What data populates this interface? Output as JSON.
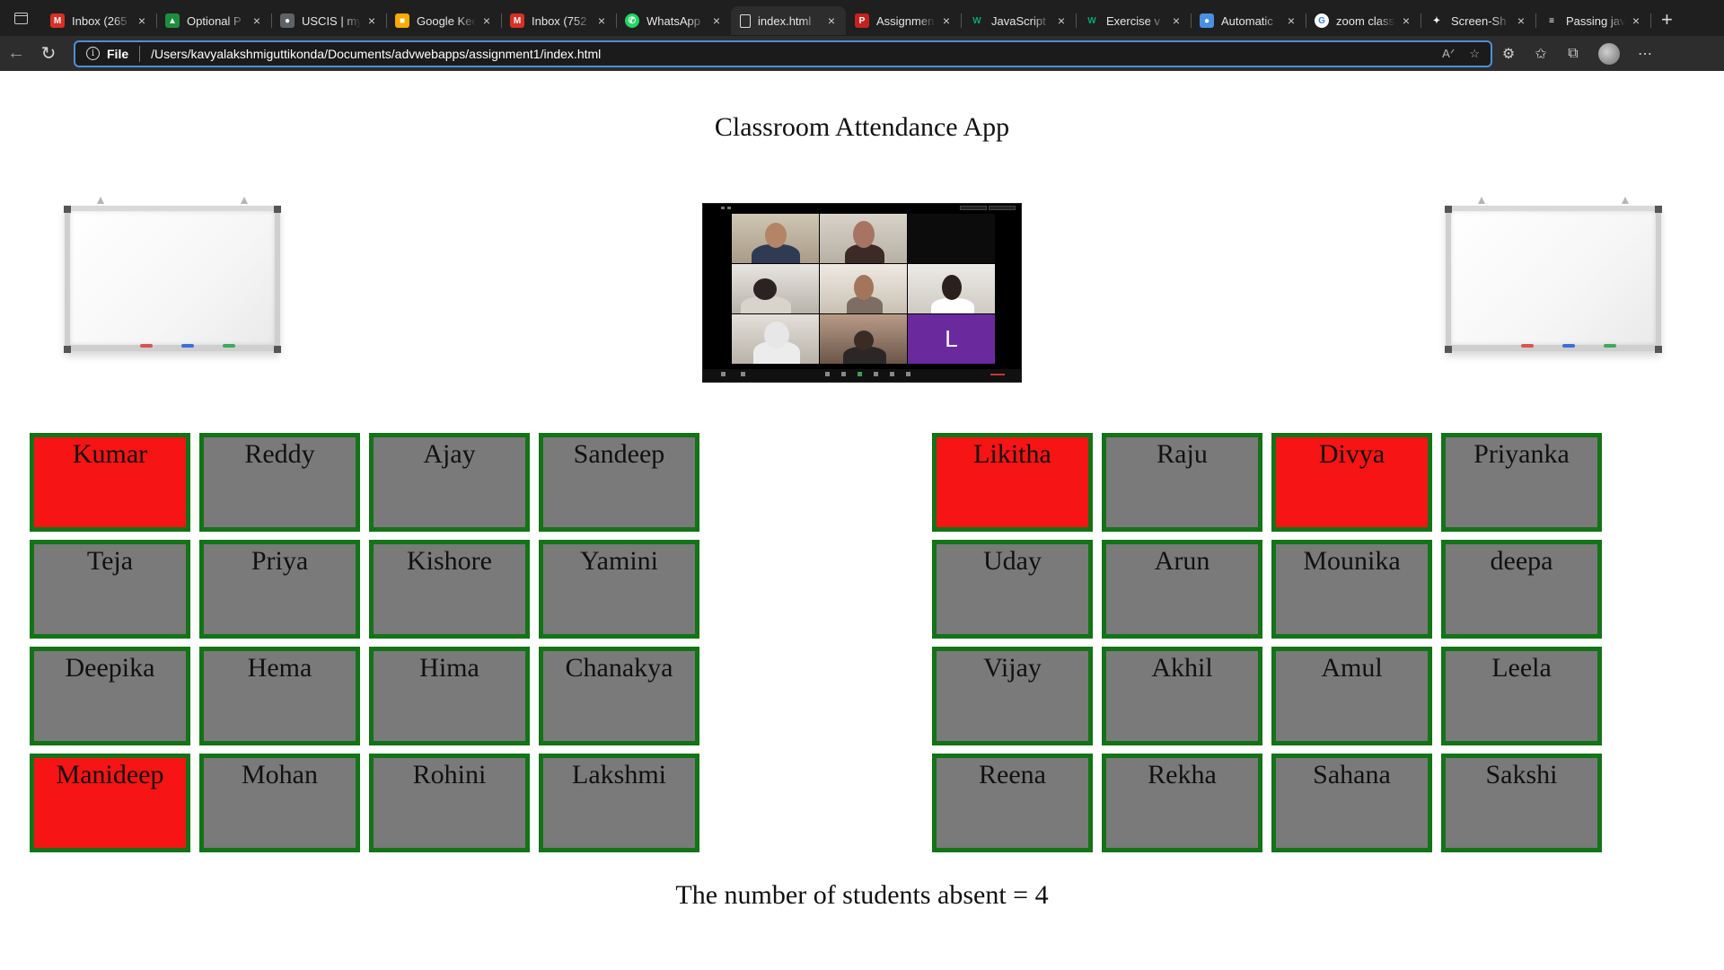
{
  "browser": {
    "tabs": [
      {
        "title": "Inbox (265",
        "icon": "gmail-icon",
        "icon_color": "#d93025",
        "glyph": "M",
        "active": false
      },
      {
        "title": "Optional P",
        "icon": "drive-icon",
        "icon_color": "#1e8e3e",
        "glyph": "▲",
        "active": false
      },
      {
        "title": "USCIS | my",
        "icon": "uscis-icon",
        "icon_color": "#5f6368",
        "glyph": "●",
        "active": false
      },
      {
        "title": "Google Kee",
        "icon": "keep-icon",
        "icon_color": "#f9ab00",
        "glyph": "■",
        "active": false
      },
      {
        "title": "Inbox (752",
        "icon": "gmail-icon",
        "icon_color": "#d93025",
        "glyph": "M",
        "active": false
      },
      {
        "title": "WhatsApp",
        "icon": "whatsapp-icon",
        "icon_color": "#25d366",
        "glyph": "✆",
        "active": false
      },
      {
        "title": "index.html",
        "icon": "file-icon",
        "icon_color": "#2d2d2d",
        "glyph": "▯",
        "active": true
      },
      {
        "title": "Assignmen",
        "icon": "pdf-icon",
        "icon_color": "#c5221f",
        "glyph": "P",
        "active": false
      },
      {
        "title": "JavaScript",
        "icon": "w3schools-icon",
        "icon_color": "#1f1f1f",
        "glyph": "W",
        "active": false
      },
      {
        "title": "Exercise v",
        "icon": "w3schools-icon",
        "icon_color": "#1f1f1f",
        "glyph": "W",
        "active": false
      },
      {
        "title": "Automatic",
        "icon": "circle-icon",
        "icon_color": "#4a90e2",
        "glyph": "●",
        "active": false
      },
      {
        "title": "zoom class",
        "icon": "google-icon",
        "icon_color": "#ffffff",
        "glyph": "G",
        "active": false
      },
      {
        "title": "Screen-Sh",
        "icon": "screenshot-icon",
        "icon_color": "#1f1f1f",
        "glyph": "✦",
        "active": false
      },
      {
        "title": "Passing jav",
        "icon": "stackoverflow-icon",
        "icon_color": "#1f1f1f",
        "glyph": "≡",
        "active": false
      }
    ],
    "address": {
      "scheme": "File",
      "url": "/Users/kavyalakshmiguttikonda/Documents/advwebapps/assignment1/index.html"
    }
  },
  "page": {
    "title": "Classroom Attendance App",
    "left_group": [
      {
        "name": "Kumar",
        "absent": true
      },
      {
        "name": "Reddy",
        "absent": false
      },
      {
        "name": "Ajay",
        "absent": false
      },
      {
        "name": "Sandeep",
        "absent": false
      },
      {
        "name": "Teja",
        "absent": false
      },
      {
        "name": "Priya",
        "absent": false
      },
      {
        "name": "Kishore",
        "absent": false
      },
      {
        "name": "Yamini",
        "absent": false
      },
      {
        "name": "Deepika",
        "absent": false
      },
      {
        "name": "Hema",
        "absent": false
      },
      {
        "name": "Hima",
        "absent": false
      },
      {
        "name": "Chanakya",
        "absent": false
      },
      {
        "name": "Manideep",
        "absent": true
      },
      {
        "name": "Mohan",
        "absent": false
      },
      {
        "name": "Rohini",
        "absent": false
      },
      {
        "name": "Lakshmi",
        "absent": false
      }
    ],
    "right_group": [
      {
        "name": "Likitha",
        "absent": true
      },
      {
        "name": "Raju",
        "absent": false
      },
      {
        "name": "Divya",
        "absent": true
      },
      {
        "name": "Priyanka",
        "absent": false
      },
      {
        "name": "Uday",
        "absent": false
      },
      {
        "name": "Arun",
        "absent": false
      },
      {
        "name": "Mounika",
        "absent": false
      },
      {
        "name": "deepa",
        "absent": false
      },
      {
        "name": "Vijay",
        "absent": false
      },
      {
        "name": "Akhil",
        "absent": false
      },
      {
        "name": "Amul",
        "absent": false
      },
      {
        "name": "Leela",
        "absent": false
      },
      {
        "name": "Reena",
        "absent": false
      },
      {
        "name": "Rekha",
        "absent": false
      },
      {
        "name": "Sahana",
        "absent": false
      },
      {
        "name": "Sakshi",
        "absent": false
      }
    ],
    "zoom_participant_initial": "L",
    "summary": "The number of students absent = 4"
  },
  "colors": {
    "present": "#7a7a7a",
    "absent": "#f71414",
    "border": "#137317",
    "zoom_letter_tile": "#6a2a9e"
  }
}
